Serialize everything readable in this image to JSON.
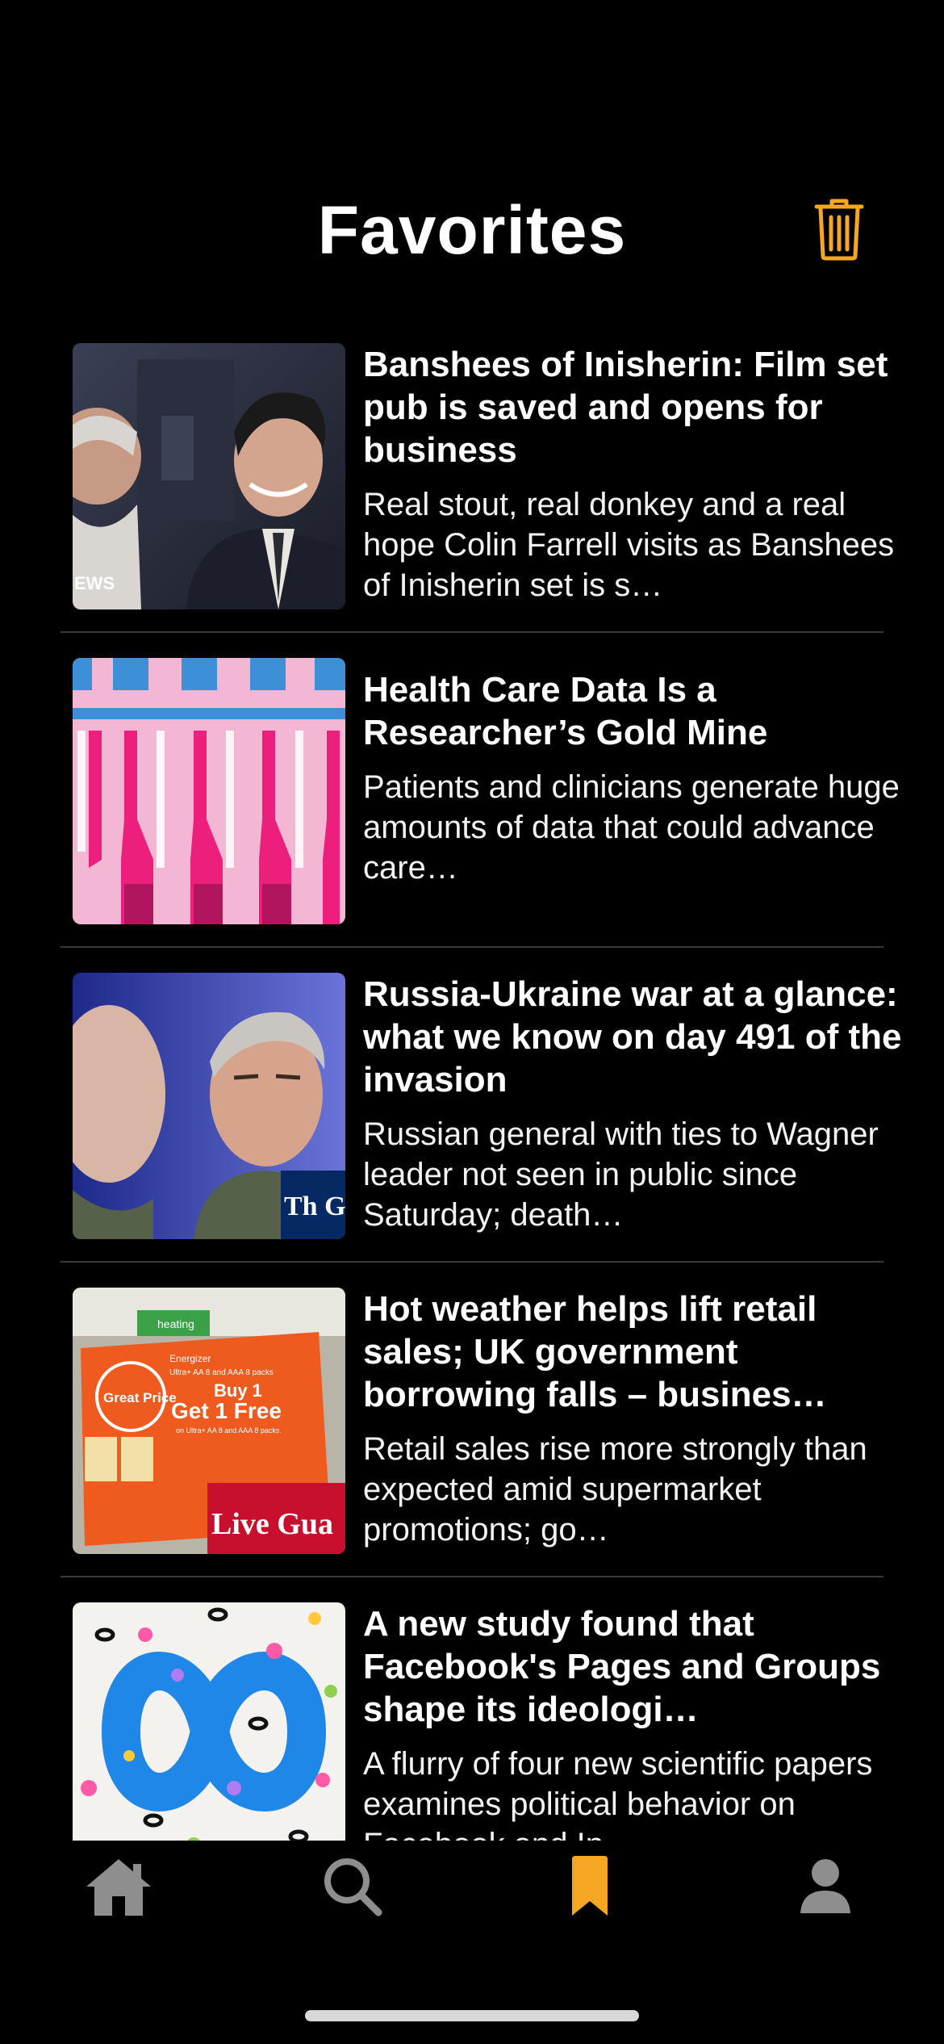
{
  "header": {
    "title": "Favorites",
    "trash_icon": "trash-icon"
  },
  "colors": {
    "accent": "#F5A623",
    "background": "#000000",
    "divider": "#3A3A3A",
    "tab_inactive": "#8E8E8E"
  },
  "articles": [
    {
      "headline": "Banshees of Inisherin: Film set pub is saved and opens for business",
      "summary": "Real stout, real donkey and a real hope Colin Farrell visits as Banshees of Inisherin set is s…",
      "thumb_caption": "EWS"
    },
    {
      "headline": "Health Care Data Is a Researcher’s Gold Mine",
      "summary": "Patients and clinicians generate huge amounts of data that could advance care…"
    },
    {
      "headline": "Russia-Ukraine war at a glance: what we know on day 491 of the invasion",
      "summary": "Russian general with ties to Wagner leader not seen in public since Saturday; death…",
      "thumb_caption": "Th Gua"
    },
    {
      "headline": "Hot weather helps lift retail sales; UK government borrowing falls – busines…",
      "summary": "Retail sales rise more strongly than expected amid supermarket promotions; go…",
      "thumb_caption": "Live Gua",
      "thumb_sign": {
        "top": "heating",
        "brand": "Energizer",
        "line1": "Ultra+ AA 8 and AAA 8 packs",
        "badge": "Great Price",
        "offer1": "Buy 1",
        "offer2": "Get 1 Free",
        "offer3": "on Ultra+ AA 8 and AAA 8 packs."
      }
    },
    {
      "headline": "A new study found that Facebook's Pages and Groups shape its ideologi…",
      "summary": "A flurry of four new scientific papers examines political behavior on Facebook and In…"
    }
  ],
  "tabs": [
    {
      "name": "home",
      "icon": "home-icon",
      "active": false
    },
    {
      "name": "search",
      "icon": "search-icon",
      "active": false
    },
    {
      "name": "favorites",
      "icon": "bookmark-icon",
      "active": true
    },
    {
      "name": "profile",
      "icon": "person-icon",
      "active": false
    }
  ]
}
